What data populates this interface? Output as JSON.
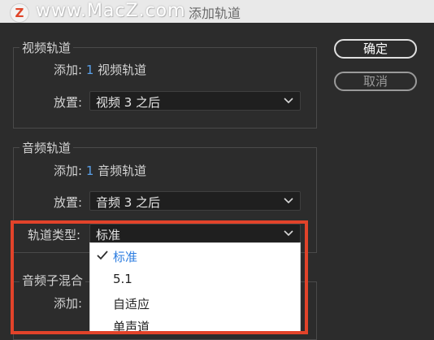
{
  "window": {
    "title": "添加轨道"
  },
  "watermark": {
    "logo_letter": "Z",
    "text": "www.MacZ.com"
  },
  "buttons": {
    "ok": "确定",
    "cancel": "取消"
  },
  "video_tracks": {
    "title": "视频轨道",
    "add_label": "添加:",
    "add_count": "1",
    "add_unit": "视频轨道",
    "place_label": "放置:",
    "place_value": "视频 3 之后"
  },
  "audio_tracks": {
    "title": "音频轨道",
    "add_label": "添加:",
    "add_count": "1",
    "add_unit": "音频轨道",
    "place_label": "放置:",
    "place_value": "音频 3 之后",
    "track_type_label": "轨道类型:",
    "track_type_value": "标准"
  },
  "audio_submix": {
    "title_partial": "音频子混合",
    "add_label": "添加:"
  },
  "track_type_options": [
    "标准",
    "5.1",
    "自适应",
    "单声道"
  ],
  "colors": {
    "highlight": "#e2432a",
    "accent": "#5aa0e8",
    "selected_option": "#2d7de0"
  }
}
